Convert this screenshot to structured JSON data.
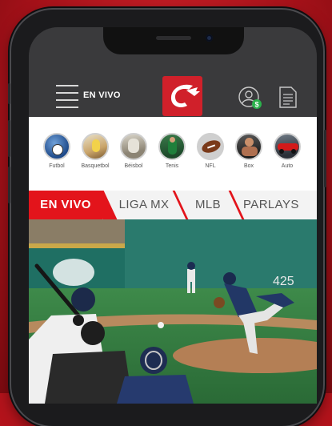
{
  "header": {
    "menu_label": "EN VIVO",
    "icons": [
      "menu-icon",
      "codere-logo",
      "user-money-icon",
      "document-icon"
    ]
  },
  "sports": [
    {
      "label": "Futbol",
      "icon": "soccer-icon"
    },
    {
      "label": "Basquetbol",
      "icon": "basketball-icon"
    },
    {
      "label": "Béisbol",
      "icon": "baseball-icon"
    },
    {
      "label": "Tenis",
      "icon": "tennis-icon"
    },
    {
      "label": "NFL",
      "icon": "football-icon"
    },
    {
      "label": "Box",
      "icon": "boxing-icon"
    },
    {
      "label": "Auto",
      "icon": "racing-car-icon"
    }
  ],
  "tabs": [
    {
      "label": "EN VIVO",
      "active": true
    },
    {
      "label": "LIGA MX",
      "active": false
    },
    {
      "label": "MLB",
      "active": false
    },
    {
      "label": "PARLAYS",
      "active": false
    }
  ],
  "photo": {
    "subject": "baseball-pitch-photo",
    "scoreboard_text": "425"
  },
  "colors": {
    "brand_red": "#e3141b",
    "appbar": "#3a3a3c",
    "background": "#b3131b"
  }
}
